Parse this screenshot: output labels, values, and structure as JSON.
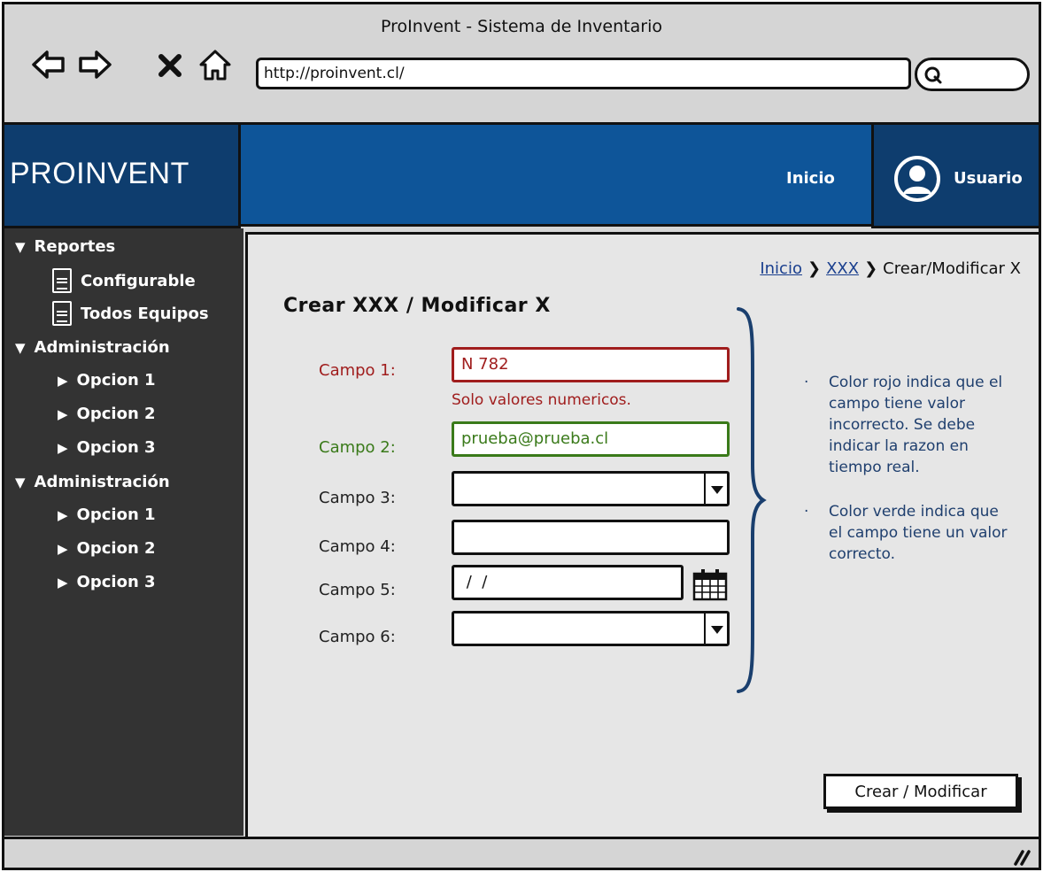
{
  "window": {
    "title": "ProInvent - Sistema de Inventario"
  },
  "browser": {
    "url": "http://proinvent.cl/",
    "icons": [
      "back-arrow-icon",
      "forward-arrow-icon",
      "close-x-icon",
      "home-icon",
      "search-icon"
    ]
  },
  "header": {
    "logo": "PROINVENT",
    "nav_home": "Inicio",
    "user_label": "Usuario",
    "colors": {
      "logo_bg": "#0e3d6e",
      "bar_bg": "#0e5599"
    }
  },
  "sidebar": {
    "sections": [
      {
        "label": "Reportes",
        "expanded": true,
        "items": [
          {
            "label": "Configurable",
            "icon": "document-icon"
          },
          {
            "label": "Todos Equipos",
            "icon": "document-icon"
          }
        ]
      },
      {
        "label": "Administración",
        "expanded": true,
        "items": [
          {
            "label": "Opcion 1"
          },
          {
            "label": "Opcion 2"
          },
          {
            "label": "Opcion 3"
          }
        ]
      },
      {
        "label": "Administración",
        "expanded": true,
        "items": [
          {
            "label": "Opcion 1"
          },
          {
            "label": "Opcion 2"
          },
          {
            "label": "Opcion 3"
          }
        ]
      }
    ]
  },
  "breadcrumb": {
    "items": [
      "Inicio",
      "XXX"
    ],
    "current": "Crear/Modificar X"
  },
  "form": {
    "title": "Crear XXX / Modificar X",
    "fields": [
      {
        "label": "Campo 1:",
        "value": "N 782",
        "state": "error",
        "error": "Solo valores numericos."
      },
      {
        "label": "Campo 2:",
        "value": "prueba@prueba.cl",
        "state": "ok"
      },
      {
        "label": "Campo 3:",
        "value": "",
        "type": "select"
      },
      {
        "label": "Campo 4:",
        "value": "",
        "type": "text"
      },
      {
        "label": "Campo 5:",
        "value": " /  /",
        "type": "date"
      },
      {
        "label": "Campo 6:",
        "value": "",
        "type": "select"
      }
    ],
    "submit": "Crear / Modificar"
  },
  "notes": [
    "Color rojo indica que el campo tiene valor incorrecto. Se debe indicar la razon en tiempo real.",
    "Color verde indica que el campo tiene un valor correcto."
  ],
  "colors": {
    "error": "#a01d1d",
    "ok": "#3a7a1a",
    "note": "#1f3f6e",
    "sidebar_bg": "#333333"
  }
}
